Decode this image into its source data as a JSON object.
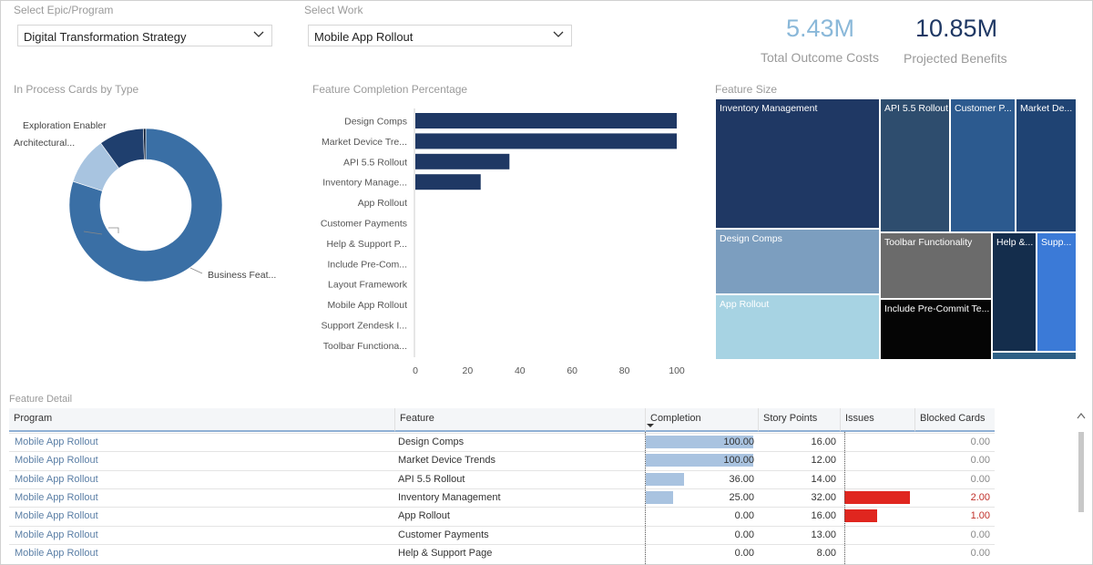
{
  "filters": {
    "epic": {
      "label": "Select Epic/Program",
      "value": "Digital Transformation Strategy"
    },
    "work": {
      "label": "Select Work",
      "value": "Mobile App Rollout"
    }
  },
  "kpis": [
    {
      "value": "5.43M",
      "label": "Total Outcome Costs",
      "color": "#8ab8d9"
    },
    {
      "value": "10.85M",
      "label": "Projected Benefits",
      "color": "#1f3864"
    }
  ],
  "donut": {
    "title": "In Process Cards by Type",
    "slices": [
      {
        "label": "Business Feat...",
        "value": 80,
        "color": "#3a6fa5"
      },
      {
        "label": "Architectural...",
        "value": 10,
        "color": "#a8c4e0"
      },
      {
        "label": "Exploration Enabler",
        "value": 9.5,
        "color": "#1f3f6e"
      },
      {
        "label": "",
        "value": 0.5,
        "color": "#0a1a33"
      }
    ]
  },
  "bar_chart": {
    "title": "Feature Completion Percentage",
    "chart_data": {
      "type": "bar",
      "orientation": "horizontal",
      "categories": [
        "Design Comps",
        "Market Device Tre...",
        "API 5.5 Rollout",
        "Inventory Manage...",
        "App Rollout",
        "Customer Payments",
        "Help & Support P...",
        "Include Pre-Com...",
        "Layout Framework",
        "Mobile App Rollout",
        "Support Zendesk I...",
        "Toolbar Functiona..."
      ],
      "values": [
        100,
        100,
        36,
        25,
        0,
        0,
        0,
        0,
        0,
        0,
        0,
        0
      ],
      "xlim": [
        0,
        100
      ],
      "xticks": [
        "0",
        "20",
        "40",
        "60",
        "80",
        "100"
      ],
      "color": "#1f3864"
    }
  },
  "treemap": {
    "title": "Feature Size",
    "tiles": [
      {
        "label": "Inventory Management",
        "color": "#1f3864"
      },
      {
        "label": "API 5.5 Rollout",
        "color": "#2e4d6e"
      },
      {
        "label": "Customer P...",
        "color": "#2c5a8f"
      },
      {
        "label": "Market De...",
        "color": "#1f4373"
      },
      {
        "label": "Design Comps",
        "color": "#7c9ebf"
      },
      {
        "label": "Toolbar Functionality",
        "color": "#6b6b6b"
      },
      {
        "label": "Help &...",
        "color": "#142d4c"
      },
      {
        "label": "Supp...",
        "color": "#3b7ad7"
      },
      {
        "label": "App Rollout",
        "color": "#a7d3e3"
      },
      {
        "label": "Include Pre-Commit Te...",
        "color": "#050505"
      },
      {
        "label": "",
        "color": "#2e5f85"
      }
    ]
  },
  "table": {
    "title": "Feature Detail",
    "columns": [
      "Program",
      "Feature",
      "Completion",
      "Story Points",
      "Issues",
      "Blocked Cards"
    ],
    "rows": [
      {
        "program": "Mobile App Rollout",
        "feature": "Design Comps",
        "completion": "100.00",
        "completion_pct": 100,
        "points": "16.00",
        "issues_level": 0,
        "blocked": "0.00",
        "blocked_red": false
      },
      {
        "program": "Mobile App Rollout",
        "feature": "Market Device Trends",
        "completion": "100.00",
        "completion_pct": 100,
        "points": "12.00",
        "issues_level": 0,
        "blocked": "0.00",
        "blocked_red": false
      },
      {
        "program": "Mobile App Rollout",
        "feature": "API 5.5 Rollout",
        "completion": "36.00",
        "completion_pct": 36,
        "points": "14.00",
        "issues_level": 0,
        "blocked": "0.00",
        "blocked_red": false
      },
      {
        "program": "Mobile App Rollout",
        "feature": "Inventory Management",
        "completion": "25.00",
        "completion_pct": 25,
        "points": "32.00",
        "issues_level": 2,
        "blocked": "2.00",
        "blocked_red": true
      },
      {
        "program": "Mobile App Rollout",
        "feature": "App Rollout",
        "completion": "0.00",
        "completion_pct": 0,
        "points": "16.00",
        "issues_level": 1,
        "blocked": "1.00",
        "blocked_red": true
      },
      {
        "program": "Mobile App Rollout",
        "feature": "Customer Payments",
        "completion": "0.00",
        "completion_pct": 0,
        "points": "13.00",
        "issues_level": 0,
        "blocked": "0.00",
        "blocked_red": false
      },
      {
        "program": "Mobile App Rollout",
        "feature": "Help & Support Page",
        "completion": "0.00",
        "completion_pct": 0,
        "points": "8.00",
        "issues_level": 0,
        "blocked": "0.00",
        "blocked_red": false
      }
    ]
  }
}
